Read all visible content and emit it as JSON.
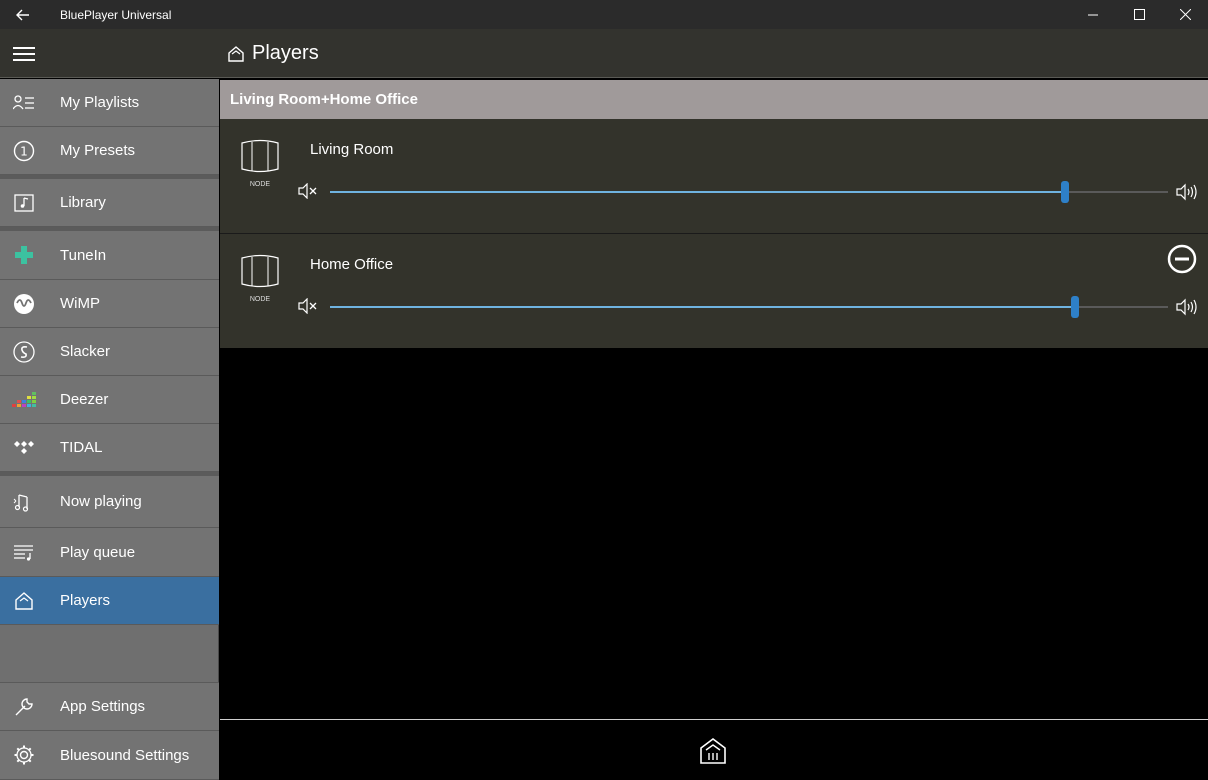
{
  "window": {
    "title": "BluePlayer Universal",
    "back_icon": "back-arrow-icon",
    "minimize_icon": "minimize-icon",
    "maximize_icon": "maximize-icon",
    "close_icon": "close-icon"
  },
  "header": {
    "title": "Players",
    "title_icon": "home-icon",
    "menu_icon": "hamburger-icon"
  },
  "sidebar": {
    "items": [
      {
        "label": "My Playlists",
        "icon": "playlist-icon"
      },
      {
        "label": "My Presets",
        "icon": "preset-number-icon"
      },
      {
        "label": "Library",
        "icon": "library-icon"
      },
      {
        "label": "TuneIn",
        "icon": "tunein-icon"
      },
      {
        "label": "WiMP",
        "icon": "wimp-icon"
      },
      {
        "label": "Slacker",
        "icon": "slacker-icon"
      },
      {
        "label": "Deezer",
        "icon": "deezer-icon"
      },
      {
        "label": "TIDAL",
        "icon": "tidal-icon"
      },
      {
        "label": "Now playing",
        "icon": "now-playing-icon"
      },
      {
        "label": "Play queue",
        "icon": "play-queue-icon"
      },
      {
        "label": "Players",
        "icon": "players-home-icon",
        "active": true
      },
      {
        "label": "App Settings",
        "icon": "wrench-icon"
      },
      {
        "label": "Bluesound Settings",
        "icon": "gear-icon"
      }
    ],
    "active_color": "#3a6fa0"
  },
  "main": {
    "group_name": "Living Room+Home Office",
    "players": [
      {
        "name": "Living Room",
        "device_label": "NODE",
        "volume_fraction": 0.877,
        "removable": false
      },
      {
        "name": "Home Office",
        "device_label": "NODE",
        "volume_fraction": 0.889,
        "removable": true
      }
    ],
    "slider_fill_color": "#6fb3e0",
    "slider_thumb_color": "#2e80c8"
  },
  "footer": {
    "icon": "home-grid-icon"
  }
}
